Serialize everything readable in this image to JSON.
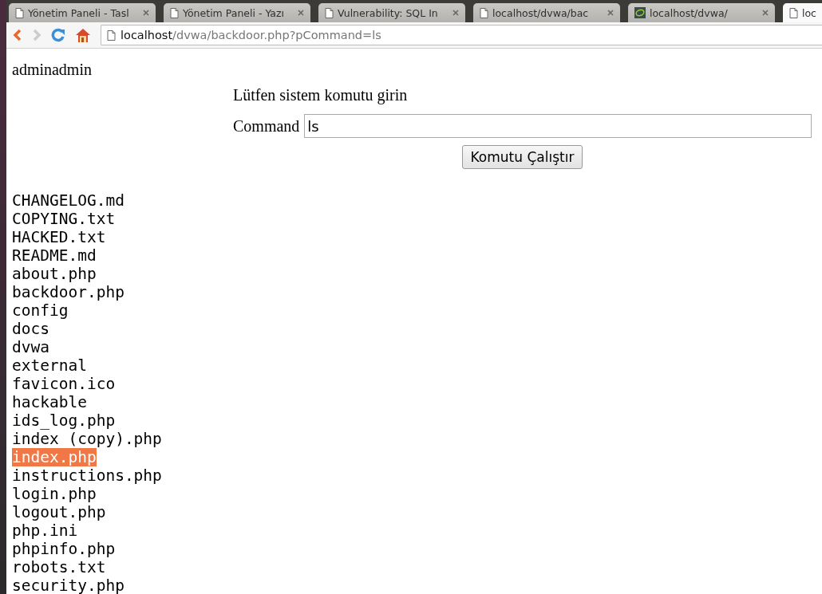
{
  "browser": {
    "tabs": [
      {
        "title": "Yönetim Paneli - Tasl",
        "kind": "page",
        "selected": false
      },
      {
        "title": "Yönetim Paneli - Yazı",
        "kind": "page",
        "selected": false
      },
      {
        "title": "Vulnerability: SQL In",
        "kind": "page",
        "selected": false
      },
      {
        "title": "localhost/dvwa/bac",
        "kind": "page",
        "selected": false
      },
      {
        "title": "localhost/dvwa/",
        "kind": "site",
        "selected": false
      },
      {
        "title": "loc",
        "kind": "page",
        "selected": true
      }
    ],
    "address": {
      "host": "localhost",
      "path": "/dvwa/backdoor.php?pCommand=ls"
    }
  },
  "page": {
    "user": "adminadmin",
    "prompt": "Lütfen sistem komutu girin",
    "command_label": "Command",
    "command_value": "ls",
    "run_button": "Komutu Çalıştır",
    "files": [
      {
        "name": "CHANGELOG.md",
        "selected": false
      },
      {
        "name": "COPYING.txt",
        "selected": false
      },
      {
        "name": "HACKED.txt",
        "selected": false
      },
      {
        "name": "README.md",
        "selected": false
      },
      {
        "name": "about.php",
        "selected": false
      },
      {
        "name": "backdoor.php",
        "selected": false
      },
      {
        "name": "config",
        "selected": false
      },
      {
        "name": "docs",
        "selected": false
      },
      {
        "name": "dvwa",
        "selected": false
      },
      {
        "name": "external",
        "selected": false
      },
      {
        "name": "favicon.ico",
        "selected": false
      },
      {
        "name": "hackable",
        "selected": false
      },
      {
        "name": "ids_log.php",
        "selected": false
      },
      {
        "name": "index (copy).php",
        "selected": false
      },
      {
        "name": "index.php",
        "selected": true
      },
      {
        "name": "instructions.php",
        "selected": false
      },
      {
        "name": "login.php",
        "selected": false
      },
      {
        "name": "logout.php",
        "selected": false
      },
      {
        "name": "php.ini",
        "selected": false
      },
      {
        "name": "phpinfo.php",
        "selected": false
      },
      {
        "name": "robots.txt",
        "selected": false
      },
      {
        "name": "security.php",
        "selected": false
      }
    ]
  }
}
